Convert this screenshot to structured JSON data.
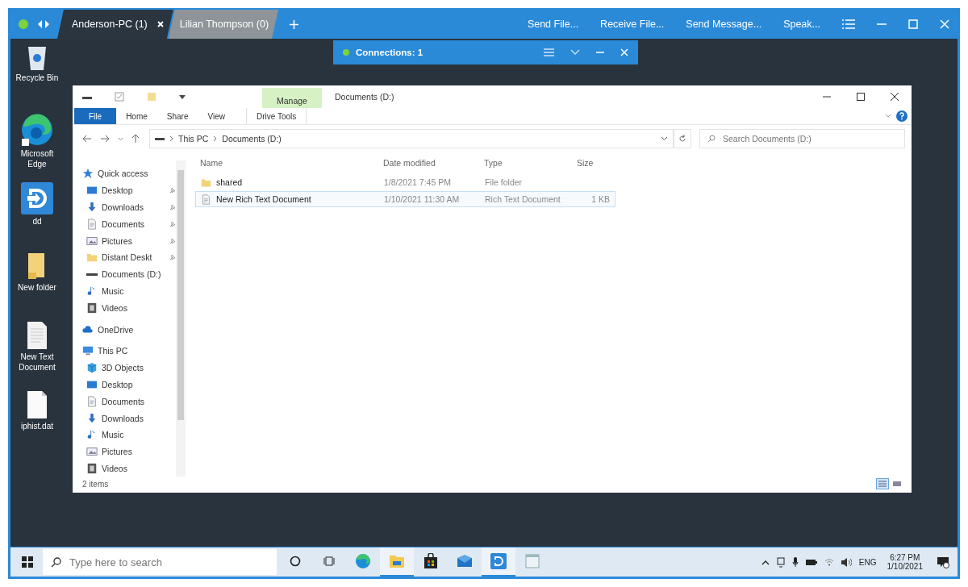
{
  "top_bar": {
    "online": true,
    "tabs": [
      {
        "label": "Anderson-PC (1)",
        "selected": true
      },
      {
        "label": "Lilian Thompson (0)",
        "selected": false
      }
    ],
    "actions": [
      "Send File...",
      "Receive File...",
      "Send Message...",
      "Speak..."
    ]
  },
  "connections": {
    "label": "Connections: 1",
    "online": true
  },
  "desktop_icons": [
    {
      "label": "Recycle Bin",
      "kind": "recycle"
    },
    {
      "label": "Microsoft Edge",
      "kind": "edge"
    },
    {
      "label": "dd",
      "kind": "app"
    },
    {
      "label": "New folder",
      "kind": "folder"
    },
    {
      "label": "New Text Document",
      "kind": "text"
    },
    {
      "label": "iphist.dat",
      "kind": "file"
    }
  ],
  "explorer": {
    "title": "Documents (D:)",
    "context_group": "Manage",
    "ribbon_tabs": [
      {
        "label": "File",
        "kind": "file"
      },
      {
        "label": "Home",
        "kind": "tab"
      },
      {
        "label": "Share",
        "kind": "tab"
      },
      {
        "label": "View",
        "kind": "tab"
      },
      {
        "label": "Drive Tools",
        "kind": "context"
      }
    ],
    "path": [
      "This PC",
      "Documents (D:)"
    ],
    "search": {
      "placeholder": "Search Documents (D:)"
    },
    "nav": [
      {
        "label": "Quick access",
        "kind": "star",
        "children": [
          {
            "label": "Desktop",
            "kind": "desktop",
            "pinned": true
          },
          {
            "label": "Downloads",
            "kind": "download",
            "pinned": true
          },
          {
            "label": "Documents",
            "kind": "doc",
            "pinned": true
          },
          {
            "label": "Pictures",
            "kind": "pictures",
            "pinned": true
          },
          {
            "label": "Distant Deskt",
            "kind": "folder",
            "pinned": true
          },
          {
            "label": "Documents (D:)",
            "kind": "drive",
            "pinned": false
          },
          {
            "label": "Music",
            "kind": "music",
            "pinned": false
          },
          {
            "label": "Videos",
            "kind": "videos",
            "pinned": false
          }
        ]
      },
      {
        "label": "OneDrive",
        "kind": "cloud"
      },
      {
        "label": "This PC",
        "kind": "pc",
        "children": [
          {
            "label": "3D Objects",
            "kind": "cube"
          },
          {
            "label": "Desktop",
            "kind": "desktop"
          },
          {
            "label": "Documents",
            "kind": "doc"
          },
          {
            "label": "Downloads",
            "kind": "download"
          },
          {
            "label": "Music",
            "kind": "music"
          },
          {
            "label": "Pictures",
            "kind": "pictures"
          },
          {
            "label": "Videos",
            "kind": "videos"
          }
        ]
      }
    ],
    "columns": [
      "Name",
      "Date modified",
      "Type",
      "Size"
    ],
    "rows": [
      {
        "name": "shared",
        "kind": "folder",
        "date": "1/8/2021 7:45 PM",
        "type": "File folder",
        "selected": false
      },
      {
        "name": "New Rich Text Document",
        "kind": "doc",
        "date": "1/10/2021 11:30 AM",
        "type": "Rich Text Document",
        "size": "1 KB",
        "selected": true
      }
    ],
    "status": "2 items"
  },
  "taskbar": {
    "search": {
      "placeholder": "Type here to search"
    },
    "apps": [
      {
        "kind": "cortana",
        "active": false
      },
      {
        "kind": "taskview",
        "active": false
      },
      {
        "kind": "edge",
        "active": false
      },
      {
        "kind": "explorer",
        "active": true
      },
      {
        "kind": "store",
        "active": false
      },
      {
        "kind": "mail",
        "active": false
      },
      {
        "kind": "app",
        "active": true
      },
      {
        "kind": "window",
        "active": false
      }
    ],
    "language": "ENG",
    "time": "6:27 PM",
    "date": "1/10/2021"
  }
}
